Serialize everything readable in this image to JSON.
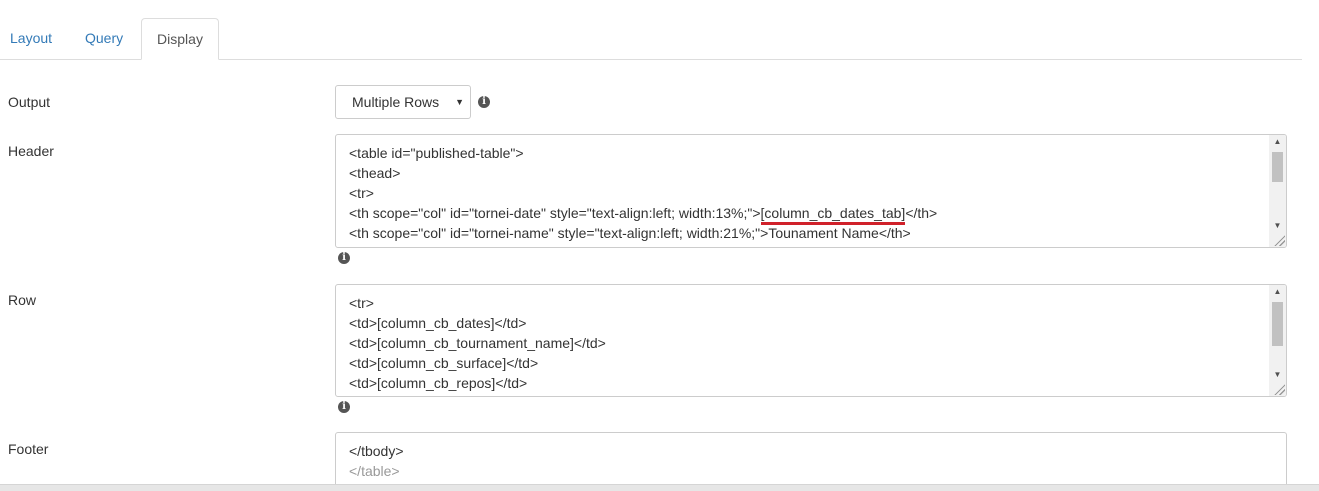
{
  "tabs": {
    "layout": "Layout",
    "query": "Query",
    "display": "Display"
  },
  "output": {
    "label": "Output",
    "selected": "Multiple Rows",
    "info_icon": "info-circle-icon"
  },
  "header": {
    "label": "Header",
    "lines": [
      "<table id=\"published-table\">",
      "<thead>",
      "<tr>",
      "<th scope=\"col\" id=\"tornei-date\" style=\"text-align:left; width:13%;\">",
      "<th scope=\"col\" id=\"tornei-name\" style=\"text-align:left; width:21%;\">Tounament Name</th>"
    ],
    "highlight_text": "[column_cb_dates_tab]",
    "line4_suffix": "</th>"
  },
  "row": {
    "label": "Row",
    "lines": [
      "<tr>",
      "<td>[column_cb_dates]</td>",
      "<td>[column_cb_tournament_name]</td>",
      "<td>[column_cb_surface]</td>",
      "<td>[column_cb_repos]</td>"
    ]
  },
  "footer": {
    "label": "Footer",
    "lines": [
      "</tbody>",
      "</table>"
    ]
  },
  "colors": {
    "link": "#337ab7",
    "highlight_underline": "#d0212a"
  }
}
